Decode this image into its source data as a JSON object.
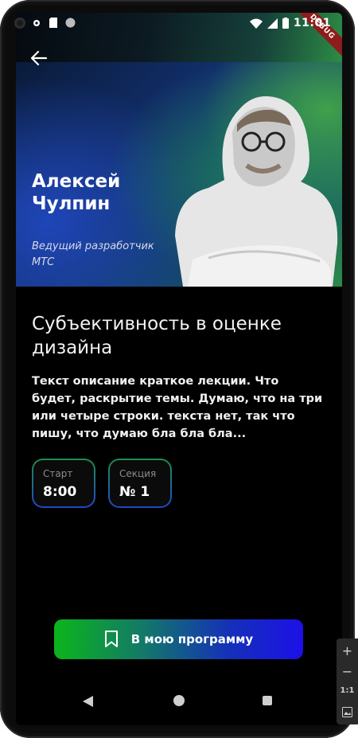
{
  "status_bar": {
    "time": "11:01",
    "left_icons": [
      "settings-icon",
      "sd-card-icon",
      "circle-icon"
    ],
    "right_icons": [
      "wifi-icon",
      "signal-icon",
      "battery-icon"
    ]
  },
  "debug_banner": "DEBUG",
  "speaker": {
    "name": "Алексей Чулпин",
    "role": "Ведущий разработчик МТС"
  },
  "lecture": {
    "title": "Субъективность в оценке дизайна",
    "description": "Текст описание краткое лекции. Что будет, раскрытие темы. Думаю, что на три или четыре строки. текста нет, так что пишу, что думаю бла бла бла..."
  },
  "chips": [
    {
      "label": "Старт",
      "value": "8:00"
    },
    {
      "label": "Секция",
      "value": "№ 1"
    }
  ],
  "cta": {
    "label": "В мою программу",
    "icon": "bookmark-icon"
  },
  "zoom_panel": {
    "plus": "+",
    "minus": "−",
    "ratio": "1:1"
  },
  "colors": {
    "background": "#000000",
    "cta_start": "#0bb51b",
    "cta_end": "#1d10e8",
    "chip_border_start": "#1e8f4a",
    "chip_border_end": "#1f47c9"
  }
}
